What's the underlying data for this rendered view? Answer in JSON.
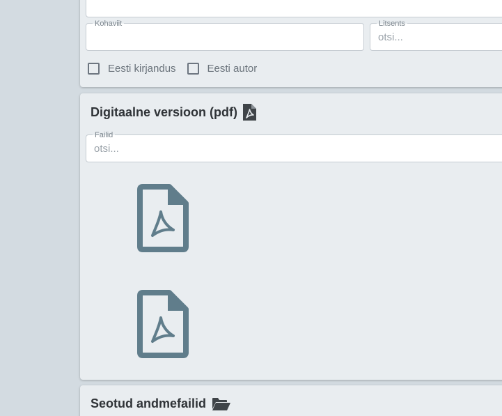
{
  "top_section": {
    "kohaviit": {
      "label": "Kohaviit",
      "value": "",
      "placeholder": ""
    },
    "litsents": {
      "label": "Litsents",
      "value": "",
      "placeholder": "otsi..."
    },
    "checkboxes": [
      {
        "label": "Eesti kirjandus",
        "checked": false
      },
      {
        "label": "Eesti autor",
        "checked": false
      }
    ]
  },
  "pdf_section": {
    "title": "Digitaalne versioon (pdf)",
    "title_icon": "file-pdf-icon",
    "files_field": {
      "label": "Failid",
      "value": "",
      "placeholder": "otsi..."
    },
    "files": [
      {
        "icon": "file-pdf-icon"
      },
      {
        "icon": "file-pdf-icon"
      }
    ],
    "icon_color": "#607d8b"
  },
  "data_section": {
    "title": "Seotud andmefailid",
    "title_icon": "folder-open-icon"
  }
}
